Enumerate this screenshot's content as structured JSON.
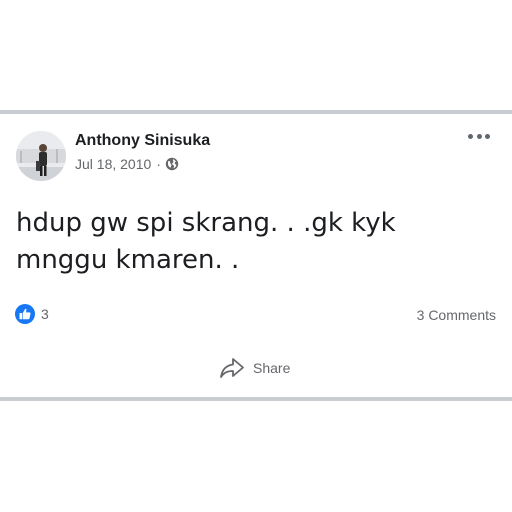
{
  "post": {
    "author": "Anthony Sinisuka",
    "date": "Jul 18, 2010",
    "separator": "·",
    "privacy_icon": "globe-icon",
    "text": "hdup gw spi skrang. . .gk kyk mnggu kmaren. .",
    "reaction_count": "3",
    "reaction_icon": "like-icon",
    "comments_label": "3 Comments",
    "share_label": "Share"
  },
  "colors": {
    "like_blue": "#1877f2",
    "divider": "#c9ccd1",
    "secondary_text": "#65676b"
  }
}
